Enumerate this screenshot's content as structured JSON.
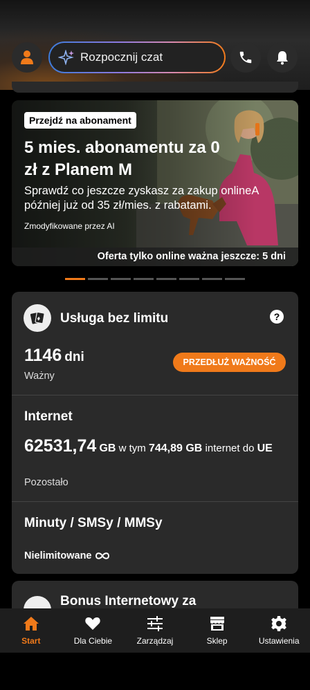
{
  "header": {
    "chat_label": "Rozpocznij czat"
  },
  "banner": {
    "badge": "Przejdź na abonament",
    "headline": "5 mies. abonamentu za 0 zł z Planem M",
    "subtitle": "Sprawdź co jeszcze zyskasz za zakup onlineA później już od 35 zł/mies. z rabatami.",
    "ai_note": "Zmodyfikowane przez AI",
    "footer": "Oferta tylko online ważna jeszcze: 5 dni"
  },
  "carousel": {
    "total_slides": 8,
    "active_index": 0
  },
  "service": {
    "title": "Usługa bez limitu",
    "help": "?",
    "days_value": "1146",
    "days_unit": "dni",
    "status": "Ważny",
    "extend_button": "PRZEDŁUŻ WAŻNOŚĆ"
  },
  "internet": {
    "title": "Internet",
    "amount": "62531,74",
    "unit": "GB",
    "text_in": "w tym",
    "eu_amount": "744,89 GB",
    "eu_text": "internet do",
    "eu_label": "UE",
    "remaining": "Pozostało"
  },
  "minutes": {
    "title": "Minuty / SMSy / MMSy",
    "value": "Nielimitowane"
  },
  "bonus": {
    "title": "Bonus Internetowy za"
  },
  "nav": {
    "items": [
      {
        "label": "Start",
        "icon": "home-icon",
        "active": true
      },
      {
        "label": "Dla Ciebie",
        "icon": "heart-icon",
        "active": false
      },
      {
        "label": "Zarządzaj",
        "icon": "sliders-icon",
        "active": false
      },
      {
        "label": "Sklep",
        "icon": "shop-icon",
        "active": false
      },
      {
        "label": "Ustawienia",
        "icon": "gear-icon",
        "active": false
      }
    ]
  },
  "colors": {
    "accent": "#f07a1a",
    "card": "#2a2a2a",
    "background": "#000000"
  }
}
